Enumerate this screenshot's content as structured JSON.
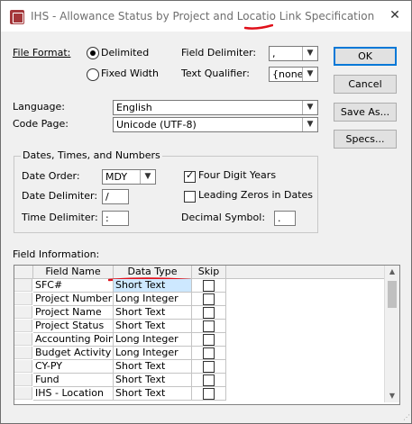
{
  "window": {
    "title": "IHS - Allowance Status by Project and Locatio Link Specification",
    "close_glyph": "✕"
  },
  "file_format": {
    "label": "File Format:",
    "delimited_label": "Delimited",
    "fixed_width_label": "Fixed Width",
    "selected": "Delimited"
  },
  "field_delimiter": {
    "label": "Field Delimiter:",
    "value": ","
  },
  "text_qualifier": {
    "label": "Text Qualifier:",
    "value": "{none}"
  },
  "language": {
    "label": "Language:",
    "value": "English"
  },
  "code_page": {
    "label": "Code Page:",
    "value": "Unicode (UTF-8)"
  },
  "buttons": {
    "ok": "OK",
    "cancel": "Cancel",
    "save_as": "Save As...",
    "specs": "Specs..."
  },
  "dates": {
    "group_title": "Dates, Times, and Numbers",
    "date_order_label": "Date Order:",
    "date_order_value": "MDY",
    "date_delimiter_label": "Date Delimiter:",
    "date_delimiter_value": "/",
    "time_delimiter_label": "Time Delimiter:",
    "time_delimiter_value": ":",
    "four_digit_years_label": "Four Digit Years",
    "four_digit_years_checked": true,
    "leading_zeros_label": "Leading Zeros in Dates",
    "leading_zeros_checked": false,
    "decimal_symbol_label": "Decimal Symbol:",
    "decimal_symbol_value": "."
  },
  "field_info": {
    "label": "Field Information:",
    "columns": [
      "Field Name",
      "Data Type",
      "Skip"
    ],
    "rows": [
      {
        "name": "SFC#",
        "type": "Short Text",
        "skip": false
      },
      {
        "name": "Project Number",
        "type": "Long Integer",
        "skip": false
      },
      {
        "name": "Project Name",
        "type": "Short Text",
        "skip": false
      },
      {
        "name": "Project Status",
        "type": "Short Text",
        "skip": false
      },
      {
        "name": "Accounting Point",
        "type": "Long Integer",
        "skip": false
      },
      {
        "name": "Budget Activity Pr",
        "type": "Long Integer",
        "skip": false
      },
      {
        "name": "CY-PY",
        "type": "Short Text",
        "skip": false
      },
      {
        "name": "Fund",
        "type": "Short Text",
        "skip": false
      },
      {
        "name": "IHS - Location",
        "type": "Short Text",
        "skip": false
      }
    ]
  },
  "colors": {
    "annotation_red": "#e0101a",
    "default_button_border": "#0078d7",
    "selected_cell": "#cde8ff"
  }
}
